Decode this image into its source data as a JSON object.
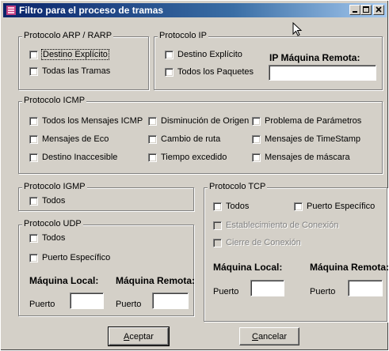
{
  "window": {
    "title": "Filtro para el proceso de tramas"
  },
  "arp": {
    "legend": "Protocolo ARP / RARP",
    "destino": "Destino Explícito",
    "todas": "Todas las Tramas"
  },
  "ip": {
    "legend": "Protocolo IP",
    "destino": "Destino Explícito",
    "todos": "Todos los Paquetes",
    "remote_label": "IP Máquina Remota:",
    "remote_value": ""
  },
  "icmp": {
    "legend": "Protocolo ICMP",
    "items": [
      "Todos los Mensajes ICMP",
      "Disminución de Origen",
      "Problema de Parámetros",
      "Mensajes de Eco",
      "Cambio de ruta",
      "Mensajes de TimeStamp",
      "Destino Inaccesible",
      "Tiempo excedido",
      "Mensajes de máscara"
    ]
  },
  "igmp": {
    "legend": "Protocolo IGMP",
    "todos": "Todos"
  },
  "udp": {
    "legend": "Protocolo UDP",
    "todos": "Todos",
    "puerto_esp": "Puerto Específico",
    "local": "Máquina Local:",
    "remota": "Máquina Remota:",
    "puerto": "Puerto"
  },
  "tcp": {
    "legend": "Protocolo TCP",
    "todos": "Todos",
    "puerto_esp": "Puerto Específico",
    "establecimiento": "Establecimiento de Conexión",
    "cierre": "Cierre de Conexión",
    "local": "Máquina Local:",
    "remota": "Máquina Remota:",
    "puerto": "Puerto"
  },
  "buttons": {
    "aceptar_ul": "A",
    "aceptar_rest": "ceptar",
    "cancelar_ul": "C",
    "cancelar_rest": "ancelar"
  }
}
